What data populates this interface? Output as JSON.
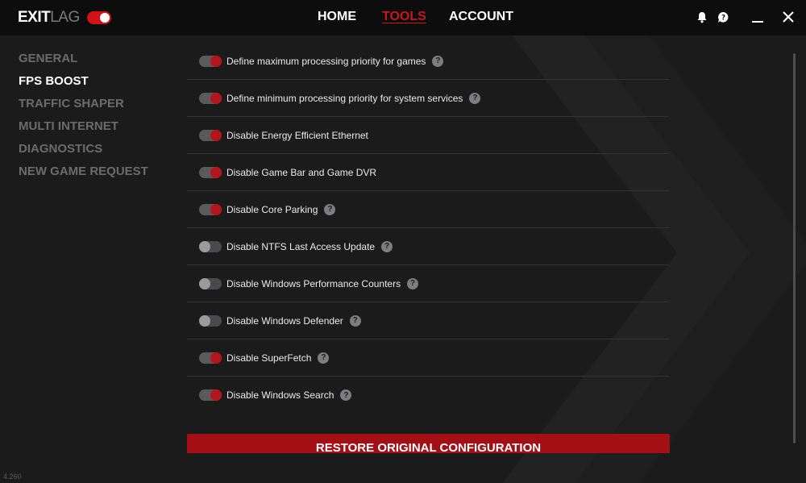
{
  "app": {
    "logo_exit": "EXIT",
    "logo_lag": "LAG",
    "version": "4.260"
  },
  "nav": {
    "home": "HOME",
    "tools": "TOOLS",
    "account": "ACCOUNT",
    "active": "tools"
  },
  "icons": {
    "notifications": "bell-icon",
    "support": "chat-help-icon",
    "minimize": "minimize-icon",
    "close": "close-icon"
  },
  "menu": {
    "items": [
      {
        "label": "GENERAL",
        "active": false
      },
      {
        "label": "FPS BOOST",
        "active": true
      },
      {
        "label": "TRAFFIC SHAPER",
        "active": false
      },
      {
        "label": "MULTI INTERNET",
        "active": false
      },
      {
        "label": "DIAGNOSTICS",
        "active": false
      },
      {
        "label": "NEW GAME REQUEST",
        "active": false
      }
    ]
  },
  "settings": [
    {
      "label": "Define maximum processing priority for games",
      "enabled": true,
      "help": true
    },
    {
      "label": "Define minimum processing priority for system services",
      "enabled": true,
      "help": true
    },
    {
      "label": "Disable Energy Efficient Ethernet",
      "enabled": true,
      "help": false
    },
    {
      "label": "Disable Game Bar and Game DVR",
      "enabled": true,
      "help": false
    },
    {
      "label": "Disable Core Parking",
      "enabled": true,
      "help": true
    },
    {
      "label": "Disable NTFS Last Access Update",
      "enabled": false,
      "help": true
    },
    {
      "label": "Disable Windows Performance Counters",
      "enabled": false,
      "help": true
    },
    {
      "label": "Disable Windows Defender",
      "enabled": false,
      "help": true
    },
    {
      "label": "Disable SuperFetch",
      "enabled": true,
      "help": true
    },
    {
      "label": "Disable Windows Search",
      "enabled": true,
      "help": true
    }
  ],
  "help_glyph": "?",
  "restore_button": "RESTORE ORIGINAL CONFIGURATION",
  "colors": {
    "accent": "#c8161b",
    "toggle_on": "#b5141a",
    "button": "#a30f14",
    "background": "#1b1b1c",
    "topbar": "#0d0d0d"
  }
}
